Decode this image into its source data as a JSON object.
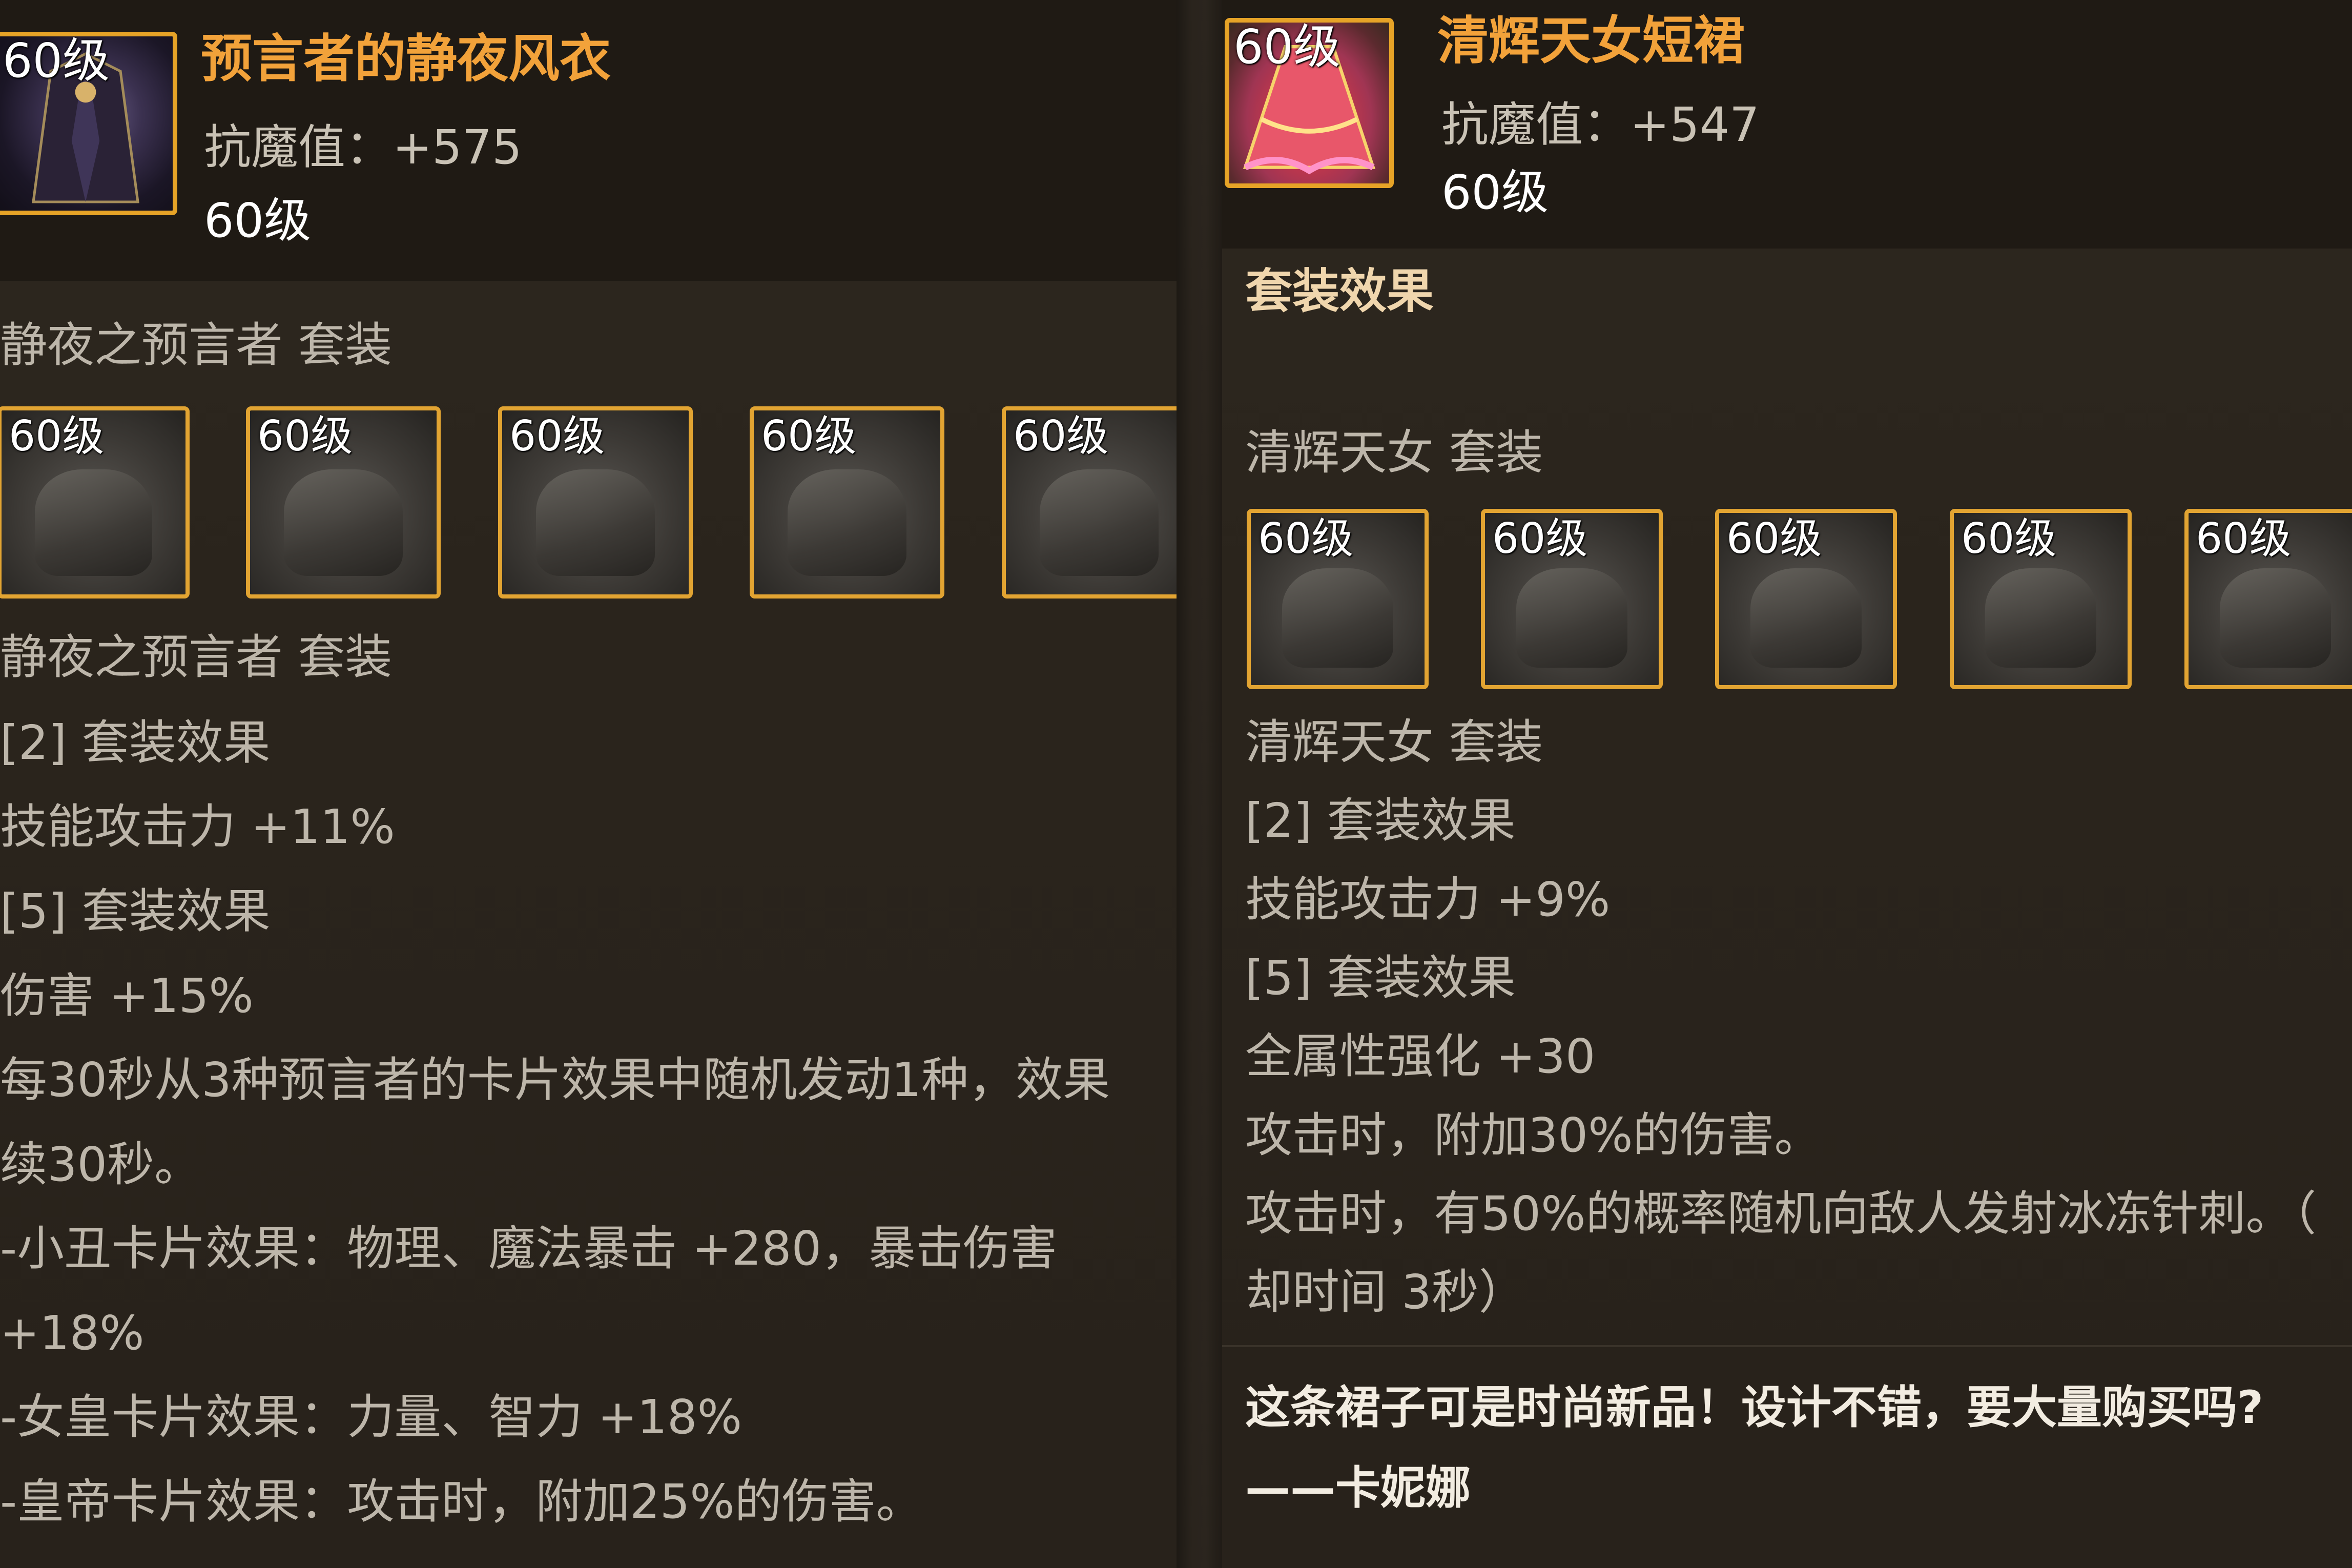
{
  "left_panel": {
    "icon_level": "60级",
    "title": "预言者的静夜风衣",
    "stat": "抗魔值：+575",
    "level": "60级",
    "set_name_1": "静夜之预言者  套装",
    "slots": [
      "60级",
      "60级",
      "60级",
      "60级",
      "60级"
    ],
    "set_name_2": "静夜之预言者  套装",
    "lines": [
      "[2] 套装效果",
      "技能攻击力 +11%",
      "[5] 套装效果",
      "伤害 +15%",
      "每30秒从3种预言者的卡片效果中随机发动1种，效果",
      "续30秒。",
      "-小丑卡片效果：物理、魔法暴击 +280，暴击伤害",
      "+18%",
      "-女皇卡片效果：力量、智力 +18%",
      "-皇帝卡片效果：攻击时，附加25%的伤害。"
    ]
  },
  "right_panel": {
    "icon_level": "60级",
    "title": "清辉天女短裙",
    "stat": "抗魔值：+547",
    "level": "60级",
    "set_effect_heading": "套装效果",
    "set_name_1": "清辉天女  套装",
    "slots": [
      "60级",
      "60级",
      "60级",
      "60级",
      "60级"
    ],
    "set_name_2": "清辉天女  套装",
    "lines": [
      "[2] 套装效果",
      "技能攻击力 +9%",
      "[5] 套装效果",
      "全属性强化 +30",
      "攻击时，附加30%的伤害。",
      "攻击时，有50%的概率随机向敌人发射冰冻针刺。（",
      "却时间 3秒）"
    ],
    "quote": "这条裙子可是时尚新品！设计不错，要大量购买吗?",
    "quote_author": "——卡妮娜"
  },
  "colors": {
    "title": "#f2a23a",
    "frame": "#e2a432",
    "body_text": "#bdb6aa"
  }
}
